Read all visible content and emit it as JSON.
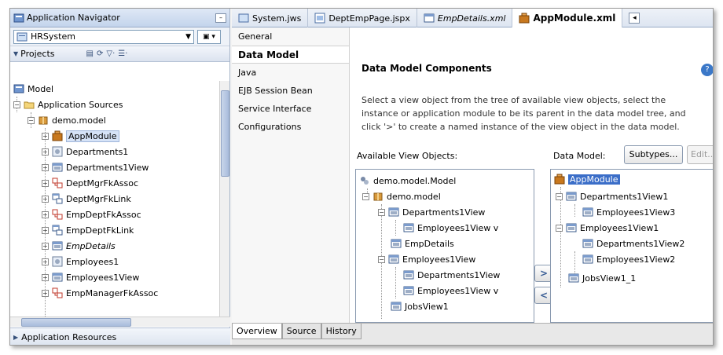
{
  "navigator": {
    "title": "Application Navigator",
    "app_combo": "HRSystem",
    "projects_label": "Projects",
    "tree": [
      {
        "label": "Model",
        "icon": "project-icon",
        "level": 0
      },
      {
        "label": "Application Sources",
        "icon": "folder-icon",
        "level": 1
      },
      {
        "label": "demo.model",
        "icon": "package-icon",
        "level": 2
      },
      {
        "label": "AppModule",
        "icon": "app-module-icon",
        "level": 3,
        "selected": true
      },
      {
        "label": "Departments1",
        "icon": "entity-object-icon",
        "level": 3
      },
      {
        "label": "Departments1View",
        "icon": "view-object-icon",
        "level": 3
      },
      {
        "label": "DeptMgrFkAssoc",
        "icon": "association-icon",
        "level": 3
      },
      {
        "label": "DeptMgrFkLink",
        "icon": "view-link-icon",
        "level": 3
      },
      {
        "label": "EmpDeptFkAssoc",
        "icon": "association-icon",
        "level": 3
      },
      {
        "label": "EmpDeptFkLink",
        "icon": "view-link-icon",
        "level": 3
      },
      {
        "label": "EmpDetails",
        "icon": "view-object-icon",
        "level": 3,
        "italic": true
      },
      {
        "label": "Employees1",
        "icon": "entity-object-icon",
        "level": 3
      },
      {
        "label": "Employees1View",
        "icon": "view-object-icon",
        "level": 3
      },
      {
        "label": "EmpManagerFkAssoc",
        "icon": "association-icon",
        "level": 3
      }
    ],
    "app_resources": "Application Resources"
  },
  "editor_tabs": [
    {
      "label": "System.jws",
      "icon": "workspace-icon"
    },
    {
      "label": "DeptEmpPage.jspx",
      "icon": "jspx-icon"
    },
    {
      "label": "EmpDetails.xml",
      "icon": "xml-icon",
      "italic": true
    },
    {
      "label": "AppModule.xml",
      "icon": "app-module-icon",
      "active": true
    }
  ],
  "side_nav": [
    "General",
    "Data Model",
    "Java",
    "EJB Session Bean",
    "Service Interface",
    "Configurations"
  ],
  "side_nav_active": "Data Model",
  "content": {
    "heading": "Data Model Components",
    "description_lines": [
      "Select a view object from the tree of available view objects, select the",
      "instance or application module to be its parent in the data model tree, and",
      "click '>' to create a named instance of the view object in the data model."
    ],
    "available_label": "Available View Objects:",
    "data_model_label": "Data Model:",
    "subtypes_button": "Subtypes...",
    "edit_button": "Edit...",
    "move_right": ">",
    "move_left": "<",
    "available_tree": [
      {
        "label": "demo.model.Model",
        "icon": "project-icon",
        "level": 0
      },
      {
        "label": "demo.model",
        "icon": "package-icon",
        "level": 1
      },
      {
        "label": "Departments1View",
        "icon": "view-object-icon",
        "level": 2
      },
      {
        "label": "Employees1View v",
        "icon": "view-object-icon",
        "level": 3
      },
      {
        "label": "EmpDetails",
        "icon": "view-object-icon",
        "level": 2
      },
      {
        "label": "Employees1View",
        "icon": "view-object-icon",
        "level": 2
      },
      {
        "label": "Departments1View",
        "icon": "view-object-icon",
        "level": 3
      },
      {
        "label": "Employees1View v",
        "icon": "view-object-icon",
        "level": 3
      },
      {
        "label": "JobsView1",
        "icon": "view-object-icon",
        "level": 2
      }
    ],
    "data_model_tree": [
      {
        "label": "AppModule",
        "icon": "app-module-icon",
        "level": 0,
        "selected": true
      },
      {
        "label": "Departments1View1",
        "icon": "view-object-icon",
        "level": 1
      },
      {
        "label": "Employees1View3",
        "icon": "view-object-icon",
        "level": 2
      },
      {
        "label": "Employees1View1",
        "icon": "view-object-icon",
        "level": 1
      },
      {
        "label": "Departments1View2",
        "icon": "view-object-icon",
        "level": 2
      },
      {
        "label": "Employees1View2",
        "icon": "view-object-icon",
        "level": 2
      },
      {
        "label": "JobsView1_1",
        "icon": "view-object-icon",
        "level": 1
      }
    ]
  },
  "bottom_tabs": [
    "Overview",
    "Source",
    "History"
  ],
  "bottom_tab_active": "Overview",
  "colors": {
    "selection": "#3b6ec8",
    "tab_accent": "#3e6fb0"
  }
}
